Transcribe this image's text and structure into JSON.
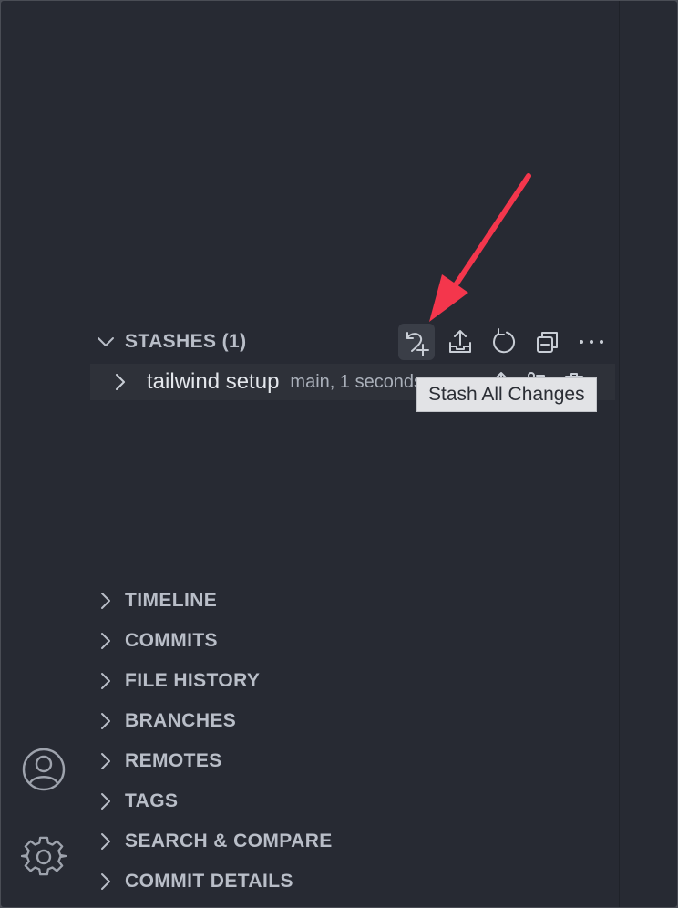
{
  "stashes": {
    "header": "STASHES (1)",
    "actions": [
      {
        "icon": "stash-all-icon",
        "active": true
      },
      {
        "icon": "stash-apply-icon"
      },
      {
        "icon": "refresh-icon"
      },
      {
        "icon": "collapse-all-icon"
      },
      {
        "icon": "more-icon"
      }
    ],
    "item": {
      "title": "tailwind setup",
      "description": "main, 1 seconds ago",
      "actions": [
        "apply-icon",
        "pop-icon",
        "delete-icon"
      ]
    },
    "tooltip": "Stash All Changes"
  },
  "sections": [
    {
      "label": "TIMELINE"
    },
    {
      "label": "COMMITS"
    },
    {
      "label": "FILE HISTORY"
    },
    {
      "label": "BRANCHES"
    },
    {
      "label": "REMOTES"
    },
    {
      "label": "TAGS"
    },
    {
      "label": "SEARCH & COMPARE"
    },
    {
      "label": "COMMIT DETAILS"
    }
  ],
  "activity_bar": {
    "icons": [
      "account-icon",
      "settings-gear-icon"
    ]
  },
  "colors": {
    "background": "#272a33",
    "annotation_arrow": "#f4364c"
  }
}
